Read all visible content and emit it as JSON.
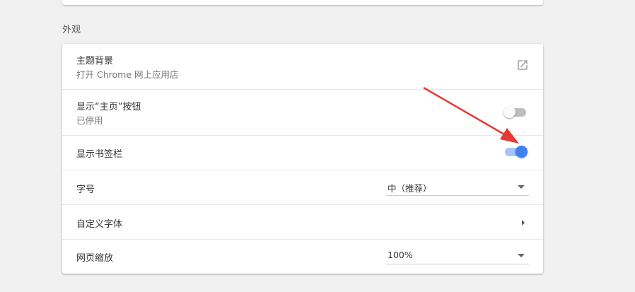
{
  "section": {
    "title": "外观"
  },
  "settings": {
    "theme": {
      "label": "主题背景",
      "sub": "打开 Chrome 网上应用店",
      "icon": "external-link-icon"
    },
    "home_button": {
      "label": "显示“主页”按钮",
      "sub": "已停用",
      "enabled": false
    },
    "bookmarks_bar": {
      "label": "显示书签栏",
      "enabled": true
    },
    "font_size": {
      "label": "字号",
      "value": "中（推荐）"
    },
    "custom_fonts": {
      "label": "自定义字体",
      "icon": "chevron-right-icon"
    },
    "zoom": {
      "label": "网页缩放",
      "value": "100%"
    }
  },
  "colors": {
    "accent": "#3f7ff0",
    "arrow": "#e53935"
  }
}
